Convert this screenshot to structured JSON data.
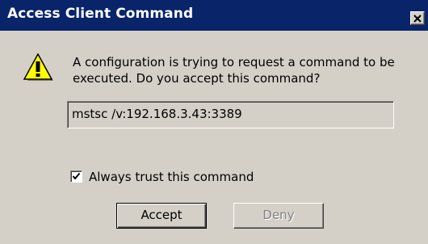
{
  "window": {
    "title": "Access Client Command",
    "titlebar_color": "#0a246a",
    "close_icon": "close-icon"
  },
  "dialog": {
    "icon": "warning-icon",
    "message_line1": "A configuration is trying to request a command to be",
    "message_line2": "executed. Do you accept this command?",
    "command_value": "mstsc /v:192.168.3.43:3389",
    "always_trust_label": "Always trust this command",
    "always_trust_checked": true,
    "accept_label": "Accept",
    "deny_label": "Deny",
    "deny_enabled": false
  }
}
